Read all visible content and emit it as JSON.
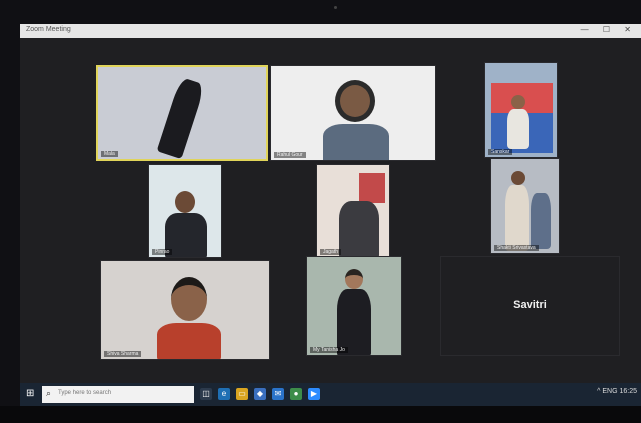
{
  "window": {
    "title": "Zoom Meeting",
    "controls": "— ☐ ✕"
  },
  "participants": [
    {
      "name": "Mala"
    },
    {
      "name": "Rahul Gour"
    },
    {
      "name": "Sanskar"
    },
    {
      "name": "Pinrao"
    },
    {
      "name": "Jagath"
    },
    {
      "name": "Shakti Srivastava"
    },
    {
      "name": "Shiva Sharma"
    },
    {
      "name": "My Tanisha Jo"
    },
    {
      "name": "Savitri"
    }
  ],
  "taskbar": {
    "start_icon": "windows-logo",
    "search_placeholder": "Type here to search",
    "apps": [
      "task-view",
      "edge",
      "file-explorer",
      "store",
      "mail",
      "chrome",
      "zoom"
    ],
    "tray_text": "^ ENG 16:25"
  },
  "colors": {
    "taskbar": "#1a2533",
    "active_speaker_border": "#e0d45a"
  }
}
